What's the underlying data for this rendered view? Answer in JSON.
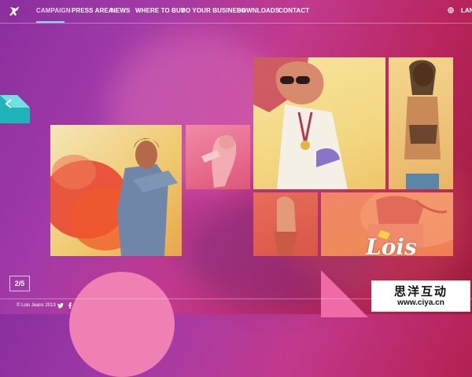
{
  "nav": {
    "items": [
      {
        "label": "CAMPAIGN",
        "active": true
      },
      {
        "label": "PRESS AREA"
      },
      {
        "label": "NEWS"
      },
      {
        "label": "WHERE TO BUY"
      },
      {
        "label": "DO YOUR BUSINESS"
      },
      {
        "label": "DOWNLOADS"
      },
      {
        "label": "CONTACT"
      }
    ],
    "language_label": "LAN",
    "icons": {
      "logo": "bull-logo-icon",
      "globe": "globe-icon"
    }
  },
  "gallery": {
    "brand_logo_text": "Lois",
    "counter": "2/5",
    "prev_icon": "chevron-left-icon"
  },
  "footer": {
    "copyright": "© Lois Jeans 2013",
    "social_icons": [
      "twitter-icon",
      "facebook-icon"
    ]
  },
  "watermark": {
    "text_cn": "思洋互动",
    "url": "www.ciya.cn"
  },
  "colors": {
    "accent": "#7ee0e6",
    "brand_pink": "#f07fb3",
    "background_from": "#8a2f9e",
    "background_to": "#9b1b3a"
  }
}
